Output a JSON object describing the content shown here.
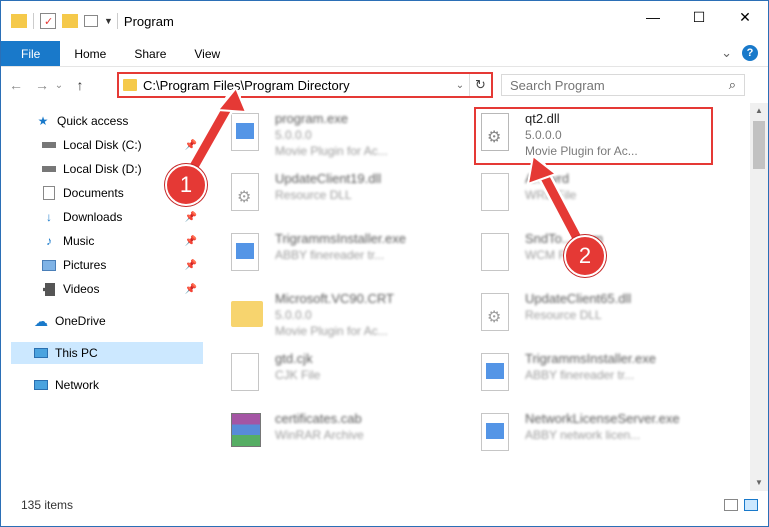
{
  "window": {
    "title": "Program",
    "controls": {
      "minimize": "—",
      "maximize": "☐",
      "close": "✕"
    }
  },
  "ribbon": {
    "tabs": [
      "File",
      "Home",
      "Share",
      "View"
    ],
    "expand": "⌄",
    "help": "?"
  },
  "address": {
    "path": "C:\\Program Files\\Program Directory",
    "refresh": "↻",
    "dropdown": "⌄"
  },
  "search": {
    "placeholder": "Search Program"
  },
  "nav": {
    "back": "←",
    "forward": "→",
    "recent": "⌄",
    "up": "↑"
  },
  "sidebar": {
    "items": [
      {
        "label": "Quick access",
        "icon": "star-icon"
      },
      {
        "label": "Local Disk (C:)",
        "icon": "drive-icon",
        "pinned": true
      },
      {
        "label": "Local Disk (D:)",
        "icon": "drive-icon"
      },
      {
        "label": "Documents",
        "icon": "documents-icon",
        "pinned": true
      },
      {
        "label": "Downloads",
        "icon": "download-icon",
        "pinned": true
      },
      {
        "label": "Music",
        "icon": "music-icon",
        "pinned": true
      },
      {
        "label": "Pictures",
        "icon": "pictures-icon",
        "pinned": true
      },
      {
        "label": "Videos",
        "icon": "videos-icon",
        "pinned": true
      },
      {
        "label": "OneDrive",
        "icon": "cloud-icon"
      },
      {
        "label": "This PC",
        "icon": "computer-icon",
        "selected": true
      },
      {
        "label": "Network",
        "icon": "network-icon"
      }
    ]
  },
  "files": [
    {
      "name": "program.exe",
      "meta1": "5.0.0.0",
      "meta2": "Movie Plugin for Ac...",
      "icon": "exe-icon"
    },
    {
      "name": "qt2.dll",
      "meta1": "5.0.0.0",
      "meta2": "Movie Plugin for Ac...",
      "icon": "dll-icon"
    },
    {
      "name": "UpdateClient19.dll",
      "meta1": "Resource DLL",
      "meta2": "",
      "icon": "dll-icon"
    },
    {
      "name": "A....wrd",
      "meta1": "WRD File",
      "meta2": "",
      "icon": "file-icon"
    },
    {
      "name": "TrigrammsInstaller.exe",
      "meta1": "ABBY finereader tr...",
      "meta2": "",
      "icon": "exe-icon"
    },
    {
      "name": "SndTo....wcm",
      "meta1": "WCM File",
      "meta2": "",
      "icon": "file-icon"
    },
    {
      "name": "Microsoft.VC90.CRT",
      "meta1": "5.0.0.0",
      "meta2": "Movie Plugin for Ac...",
      "icon": "folder-icon"
    },
    {
      "name": "UpdateClient65.dll",
      "meta1": "Resource DLL",
      "meta2": "",
      "icon": "dll-icon"
    },
    {
      "name": "gtd.cjk",
      "meta1": "CJK File",
      "meta2": "",
      "icon": "file-icon"
    },
    {
      "name": "TrigrammsInstaller.exe",
      "meta1": "ABBY finereader tr...",
      "meta2": "",
      "icon": "exe-icon"
    },
    {
      "name": "certificates.cab",
      "meta1": "WinRAR Archive",
      "meta2": "",
      "icon": "archive-icon"
    },
    {
      "name": "NetworkLicenseServer.exe",
      "meta1": "ABBY network licen...",
      "meta2": "",
      "icon": "exe-icon"
    }
  ],
  "status": {
    "count": "135 items"
  },
  "callouts": {
    "one": "1",
    "two": "2"
  },
  "colors": {
    "accent": "#1979ca",
    "highlight": "#e53935",
    "selection": "#cce8ff"
  }
}
